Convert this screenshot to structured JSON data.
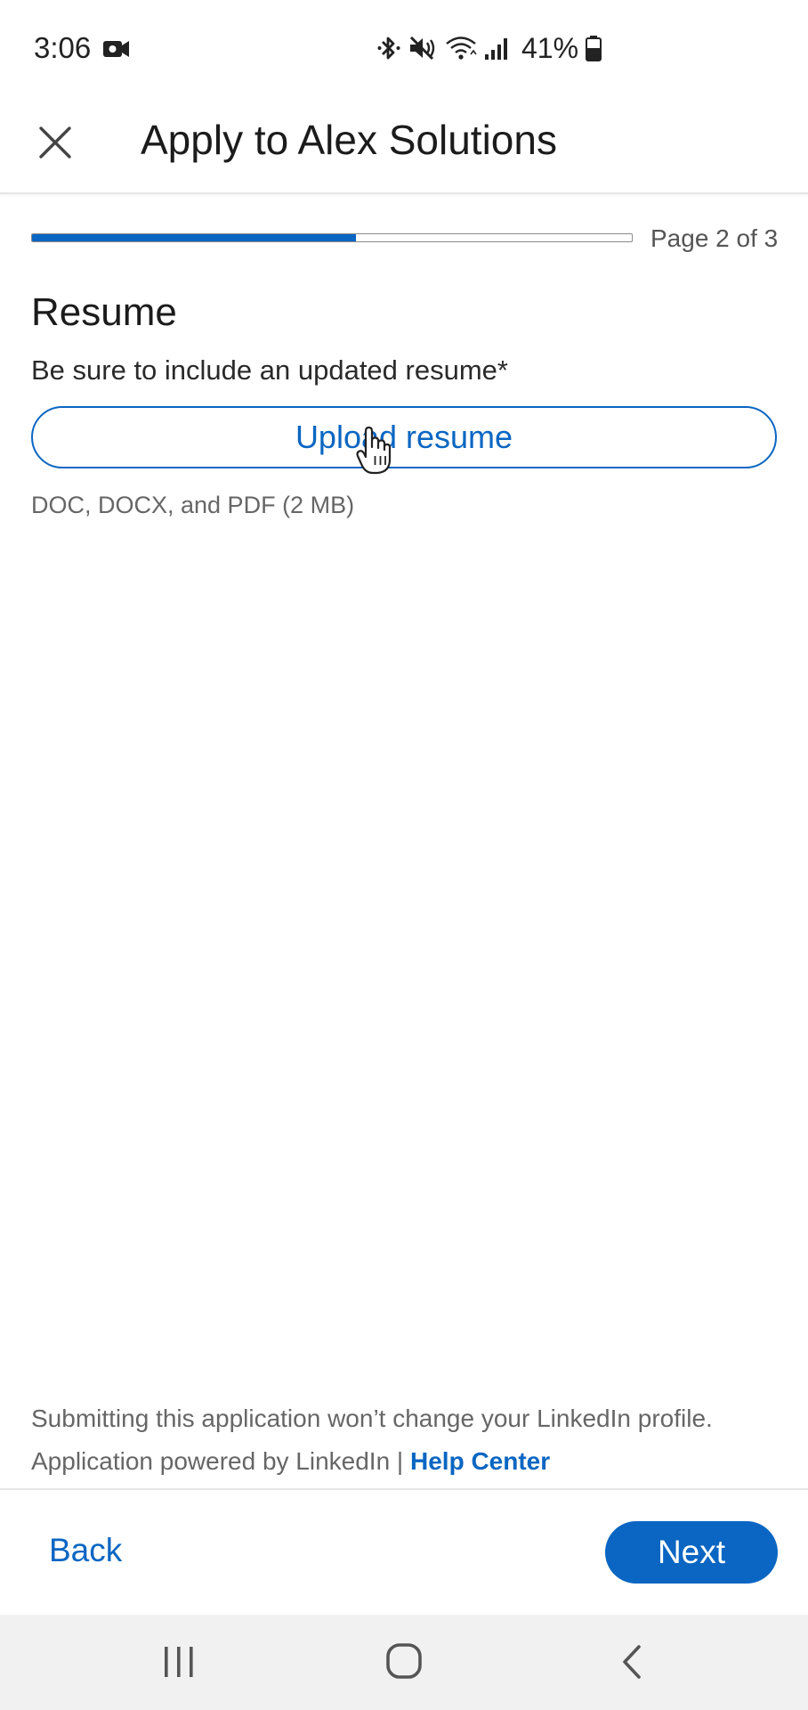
{
  "status_bar": {
    "time": "3:06",
    "battery": "41%"
  },
  "header": {
    "title": "Apply to Alex Solutions",
    "close_icon": "close-icon"
  },
  "progress": {
    "label": "Page 2 of 3",
    "current_page": 2,
    "total_pages": 3,
    "fill_fraction": 0.54
  },
  "resume": {
    "section_title": "Resume",
    "field_label": "Be sure to include an updated resume*",
    "upload_label": "Upload resume",
    "hint": "DOC, DOCX, and PDF (2 MB)"
  },
  "footer": {
    "note": "Submitting this application won’t change your LinkedIn profile.",
    "powered_by": "Application powered by LinkedIn | ",
    "help_link": "Help Center"
  },
  "actions": {
    "back_label": "Back",
    "next_label": "Next"
  },
  "colors": {
    "accent": "#0a66c2",
    "text_primary": "#1b1b1b",
    "text_secondary": "#666666",
    "nav_bar_bg": "#f1f1f1"
  }
}
